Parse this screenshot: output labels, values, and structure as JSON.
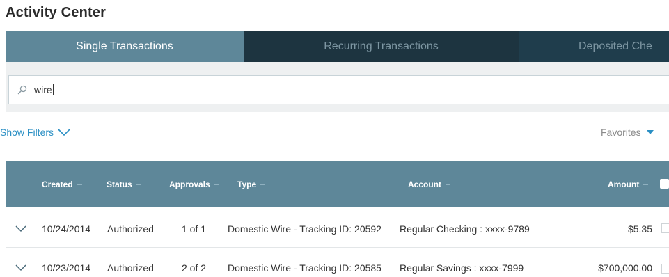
{
  "page": {
    "title": "Activity Center"
  },
  "tabs": [
    {
      "label": "Single Transactions",
      "active": true
    },
    {
      "label": "Recurring Transactions",
      "active": false
    },
    {
      "label": "Deposited Che",
      "active": false
    }
  ],
  "search": {
    "value": "wire",
    "icon": "search-icon"
  },
  "filters": {
    "show_filters_label": "Show Filters",
    "favorites_label": "Favorites"
  },
  "table": {
    "columns": [
      "Created",
      "Status",
      "Approvals",
      "Type",
      "Account",
      "Amount"
    ],
    "rows": [
      {
        "created": "10/24/2014",
        "status": "Authorized",
        "approvals": "1 of 1",
        "type": "Domestic Wire - Tracking ID: 20592",
        "account": "Regular Checking : xxxx-9789",
        "amount": "$5.35"
      },
      {
        "created": "10/23/2014",
        "status": "Authorized",
        "approvals": "2 of 2",
        "type": "Domestic Wire - Tracking ID: 20585",
        "account": "Regular Savings : xxxx-7999",
        "amount": "$700,000.00"
      }
    ]
  },
  "colors": {
    "accent": "#2a8fc4",
    "tab_active": "#5e8799",
    "tab_dark": "#1f3d4c",
    "header": "#5e8799"
  }
}
